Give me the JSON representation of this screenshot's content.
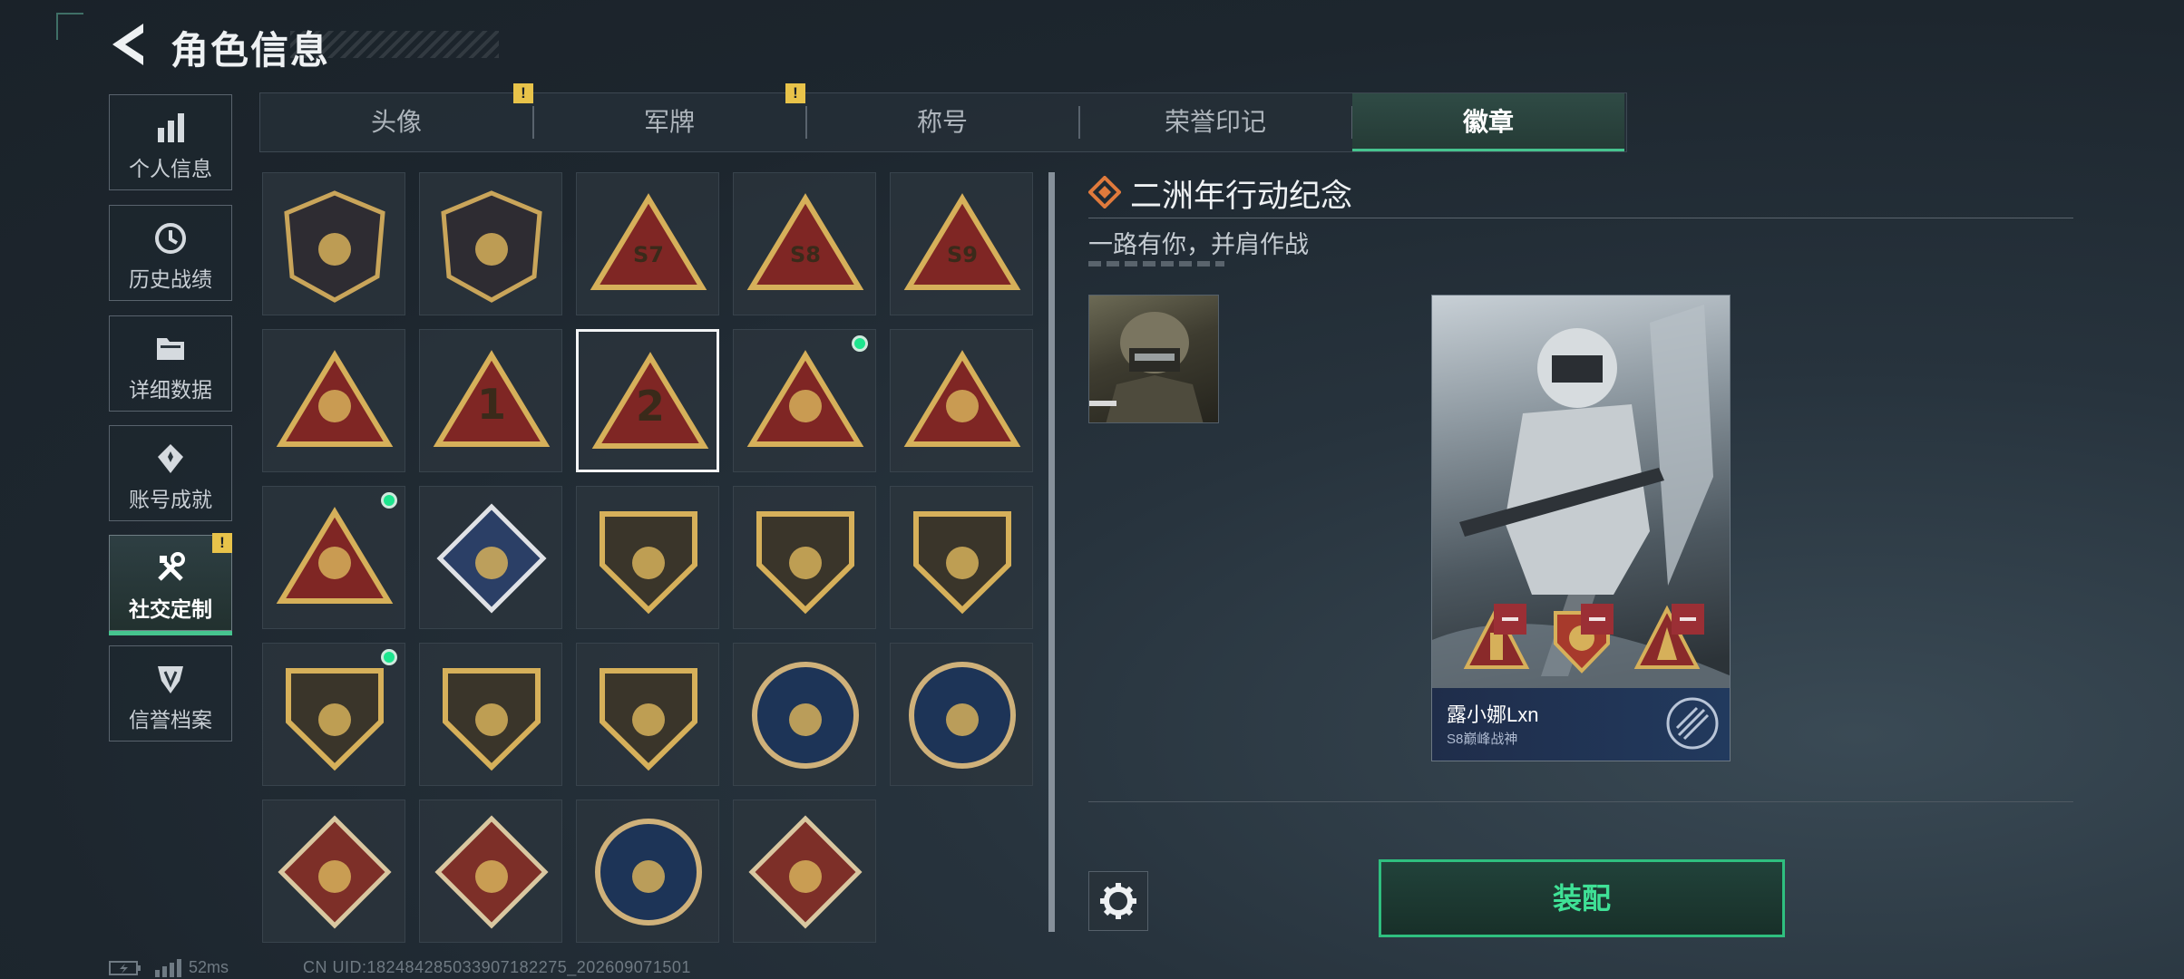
{
  "header": {
    "title": "角色信息"
  },
  "nav": [
    {
      "label": "个人信息",
      "icon": "bar-chart-icon"
    },
    {
      "label": "历史战绩",
      "icon": "clock-icon"
    },
    {
      "label": "详细数据",
      "icon": "folder-icon"
    },
    {
      "label": "账号成就",
      "icon": "achievement-icon"
    },
    {
      "label": "社交定制",
      "icon": "tools-icon",
      "active": true,
      "alert": "!"
    },
    {
      "label": "信誉档案",
      "icon": "shield-emblem-icon"
    }
  ],
  "tabs": [
    {
      "label": "头像",
      "alert": "!"
    },
    {
      "label": "军牌",
      "alert": "!"
    },
    {
      "label": "称号"
    },
    {
      "label": "荣誉印记"
    },
    {
      "label": "徽章",
      "active": true
    }
  ],
  "badges": [
    {
      "name": "badge-triangle-logo"
    },
    {
      "name": "badge-helicopter"
    },
    {
      "name": "badge-s7",
      "text": "S7"
    },
    {
      "name": "badge-s8",
      "text": "S8"
    },
    {
      "name": "badge-s9",
      "text": "S9"
    },
    {
      "name": "badge-fist"
    },
    {
      "name": "badge-number-1",
      "text": "1"
    },
    {
      "name": "badge-number-2",
      "text": "2",
      "selected": true
    },
    {
      "name": "badge-usb",
      "new": true
    },
    {
      "name": "badge-soldiers"
    },
    {
      "name": "badge-rocket",
      "new": true
    },
    {
      "name": "badge-rose"
    },
    {
      "name": "badge-star-eagle"
    },
    {
      "name": "badge-chevron-shield"
    },
    {
      "name": "badge-star-shield"
    },
    {
      "name": "badge-gem-shield",
      "new": true
    },
    {
      "name": "badge-rifle-shield"
    },
    {
      "name": "badge-target-shield"
    },
    {
      "name": "badge-eagle"
    },
    {
      "name": "badge-wasp"
    },
    {
      "name": "badge-dragon"
    },
    {
      "name": "badge-runner"
    },
    {
      "name": "badge-wolf"
    },
    {
      "name": "badge-drill"
    }
  ],
  "detail": {
    "title": "二洲年行动纪念",
    "subtitle": "一路有你，并肩作战",
    "card_name": "露小娜Lxn",
    "card_sub": "S8巅峰战神",
    "equip_label": "装配"
  },
  "status": {
    "ping": "52ms",
    "uid": "CN UID:18248428503390718​2275_202609071501"
  },
  "colors": {
    "accent": "#46c48f",
    "warn": "#e8c34a",
    "dot": "#1de58e"
  }
}
